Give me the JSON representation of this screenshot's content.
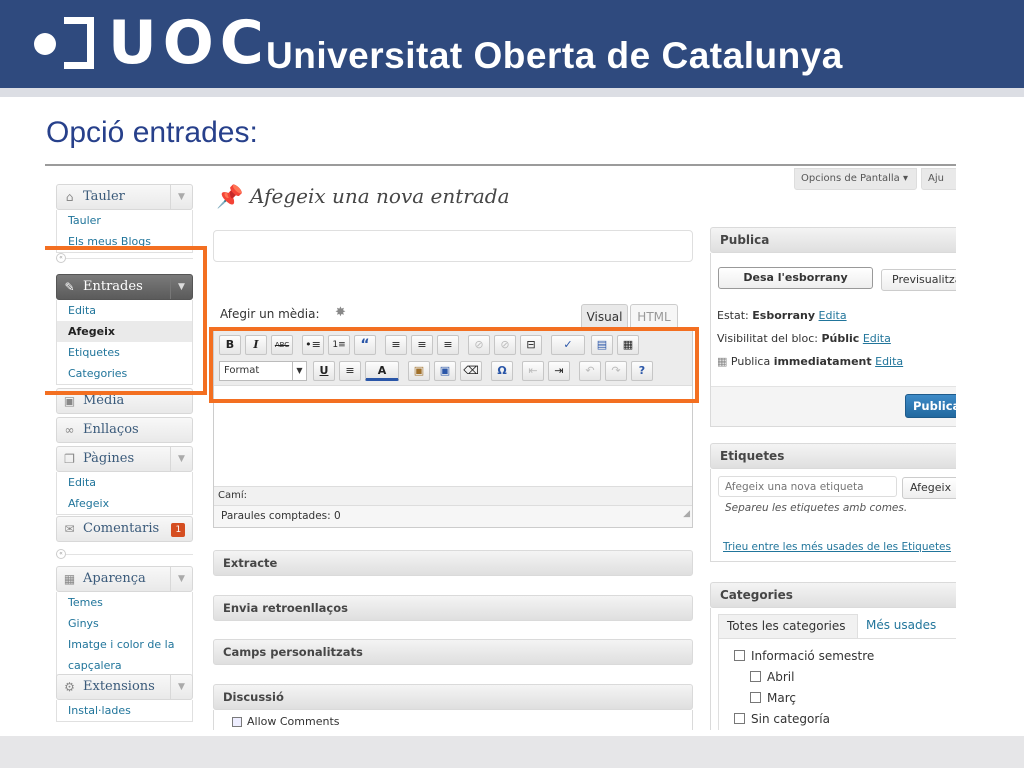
{
  "banner": {
    "logo_text": "UOC",
    "university_name": "Universitat Oberta de Catalunya"
  },
  "slide": {
    "title": "Opció entrades:"
  },
  "menu": {
    "tauler": {
      "label": "Tauler",
      "items": [
        "Tauler",
        "Els meus Blogs"
      ]
    },
    "entrades": {
      "label": "Entrades",
      "items": [
        "Edita",
        "Afegeix",
        "Etiquetes",
        "Categories"
      ]
    },
    "media": {
      "label": "Mèdia"
    },
    "enllacos": {
      "label": "Enllaços"
    },
    "pagines": {
      "label": "Pàgines",
      "items": [
        "Edita",
        "Afegeix"
      ]
    },
    "comentaris": {
      "label": "Comentaris",
      "badge": "1"
    },
    "aparenca": {
      "label": "Aparença",
      "items": [
        "Temes",
        "Ginys",
        "Imatge i color de la",
        "capçalera"
      ]
    },
    "extensions": {
      "label": "Extensions",
      "items": [
        "Instal·lades"
      ]
    }
  },
  "editor": {
    "page_heading": "Afegeix una nova entrada",
    "title_value": "",
    "media_label": "Afegir un mèdia:",
    "tab_visual": "Visual",
    "tab_html": "HTML",
    "format_select": "Format",
    "path_label": "Camí:",
    "word_count": "Paraules comptades: 0",
    "toolbar_row1": [
      "B",
      "I",
      "ABC",
      "•≡",
      "1≡",
      "“",
      "≡",
      "≡",
      "≡",
      "⊘",
      "⊘",
      "⊟",
      "✓",
      "▤",
      "▦"
    ],
    "toolbar_row2": [
      "U",
      "≡",
      "A",
      "▣",
      "▣",
      "⌫",
      "Ω",
      "⇤",
      "⇥",
      "↶",
      "↷",
      "?"
    ]
  },
  "postboxes": {
    "extracte": "Extracte",
    "retroenllacos": "Envia retroenllaços",
    "camps": "Camps personalitzats",
    "discussio": "Discussió",
    "allow_comments": "Allow Comments"
  },
  "topbar": {
    "screen_options": "Opcions de Pantalla ▾",
    "help": "Aju"
  },
  "publish": {
    "title": "Publica",
    "save_draft": "Desa l'esborrany",
    "preview": "Previsualitza",
    "status_label": "Estat:",
    "status_value": "Esborrany",
    "edit_link": "Edita",
    "visibility_label": "Visibilitat del bloc:",
    "visibility_value": "Públic",
    "schedule_label": "Publica",
    "schedule_value": "immediatament",
    "publish_button": "Publica"
  },
  "tags": {
    "title": "Etiquetes",
    "input_placeholder": "Afegeix una nova etiqueta",
    "add_button": "Afegeix",
    "hint": "Separeu les etiquetes amb comes.",
    "choose_link": "Trieu entre les més usades de les Etiquetes"
  },
  "categories": {
    "title": "Categories",
    "tab_all": "Totes les categories",
    "tab_popular": "Més usades",
    "items": [
      {
        "label": "Informació semestre",
        "level": 0
      },
      {
        "label": "Abril",
        "level": 1
      },
      {
        "label": "Març",
        "level": 1
      },
      {
        "label": "Sin categoría",
        "level": 0
      }
    ]
  },
  "colors": {
    "banner": "#2f4a7e",
    "title": "#27408b",
    "highlight": "#f36f21",
    "link": "#21759b"
  }
}
